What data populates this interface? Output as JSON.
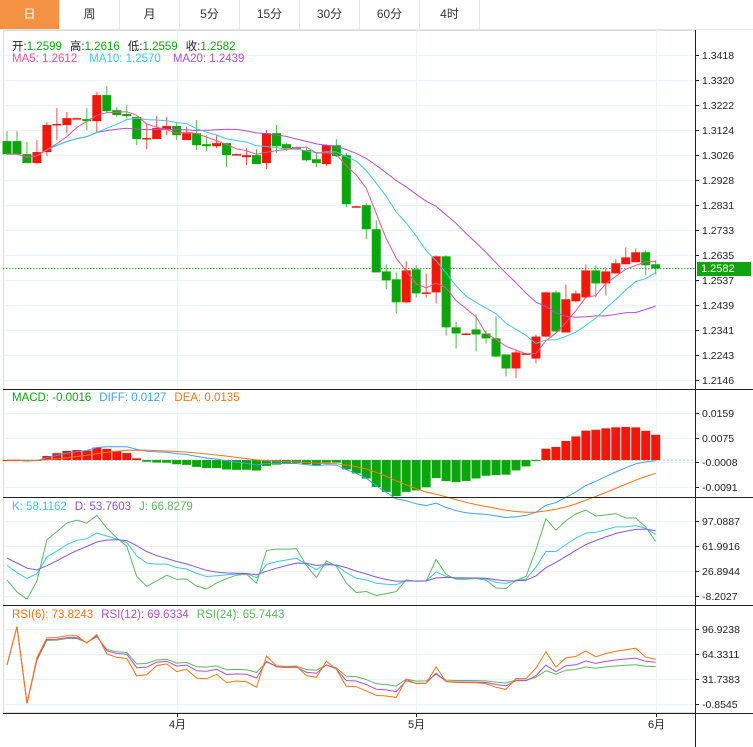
{
  "tabs": [
    "日",
    "周",
    "月",
    "5分",
    "15分",
    "30分",
    "60分",
    "4时"
  ],
  "active_tab": 0,
  "ohlc_legend": {
    "open_label": "开:",
    "open": "1.2599",
    "high_label": "高:",
    "high": "1.2616",
    "low_label": "低:",
    "low": "1.2559",
    "close_label": "收:",
    "close": "1.2582"
  },
  "ma_legend": {
    "ma5": "MA5: 1.2612",
    "ma10": "MA10: 1.2570",
    "ma20": "MA20: 1.2439"
  },
  "macd_legend": {
    "macd": "MACD: -0.0016",
    "diff": "DIFF: 0.0127",
    "dea": "DEA: 0.0135"
  },
  "kdj_legend": {
    "k": "K: 58.1162",
    "d": "D: 53.7603",
    "j": "J: 66.8279"
  },
  "rsi_legend": {
    "rsi6": "RSI(6): 73.8243",
    "rsi12": "RSI(12): 69.6334",
    "rsi24": "RSI(24): 65.7443"
  },
  "current_price": "1.2582",
  "colors": {
    "up": "#f0180a",
    "down": "#0da50d",
    "ma5": "#e8578a",
    "ma10": "#3cc8e0",
    "ma20": "#b050c8",
    "diff": "#3f9fff",
    "dea": "#ff7416",
    "k": "#3cc8e0",
    "d": "#8458d8",
    "j": "#5cb85c",
    "rsi6": "#ff7416",
    "rsi12": "#b050c8",
    "rsi24": "#5cb85c",
    "tab_active": "#f39242"
  },
  "chart_data": {
    "type": "candlestick",
    "x_ticks": [
      {
        "label": "4月",
        "index": 17
      },
      {
        "label": "5月",
        "index": 41
      },
      {
        "label": "6月",
        "index": 65
      }
    ],
    "price_axis": [
      "1.3418",
      "1.3320",
      "1.3222",
      "1.3124",
      "1.3026",
      "1.2928",
      "1.2831",
      "1.2733",
      "1.2635",
      "1.2537",
      "1.2439",
      "1.2341",
      "1.2243",
      "1.2146"
    ],
    "macd_axis": [
      "0.0159",
      "0.0075",
      "-0.0008",
      "-0.0091"
    ],
    "kdj_axis": [
      "97.0887",
      "61.9916",
      "26.8944",
      "-8.2027"
    ],
    "rsi_axis": [
      "96.9238",
      "64.3311",
      "31.7383",
      "-0.8545"
    ],
    "candles": [
      [
        1.3081,
        1.312,
        1.3026,
        1.303
      ],
      [
        1.3081,
        1.312,
        1.3026,
        1.303
      ],
      [
        1.303,
        1.3077,
        1.2995,
        1.2995
      ],
      [
        1.2995,
        1.3085,
        1.2991,
        1.3038
      ],
      [
        1.3038,
        1.3155,
        1.3022,
        1.3144
      ],
      [
        1.3144,
        1.321,
        1.3085,
        1.3148
      ],
      [
        1.3144,
        1.3195,
        1.3112,
        1.3171
      ],
      [
        1.3169,
        1.3173,
        1.3167,
        1.3171
      ],
      [
        1.3167,
        1.321,
        1.3124,
        1.3159
      ],
      [
        1.3159,
        1.3273,
        1.3116,
        1.3261
      ],
      [
        1.3261,
        1.3296,
        1.3191,
        1.3198
      ],
      [
        1.3202,
        1.3214,
        1.3175,
        1.3183
      ],
      [
        1.3187,
        1.3222,
        1.3171,
        1.3179
      ],
      [
        1.3175,
        1.3175,
        1.3065,
        1.3089
      ],
      [
        1.3091,
        1.3151,
        1.3049,
        1.3093
      ],
      [
        1.3089,
        1.3179,
        1.3112,
        1.3132
      ],
      [
        1.3128,
        1.3175,
        1.3104,
        1.314
      ],
      [
        1.314,
        1.3151,
        1.3085,
        1.3104
      ],
      [
        1.3085,
        1.3136,
        1.3085,
        1.3112
      ],
      [
        1.3112,
        1.3163,
        1.3046,
        1.3065
      ],
      [
        1.3069,
        1.3104,
        1.3042,
        1.3061
      ],
      [
        1.3061,
        1.3104,
        1.3053,
        1.3073
      ],
      [
        1.3073,
        1.3073,
        1.2979,
        1.3026
      ],
      [
        1.3029,
        1.3032,
        1.3027,
        1.303
      ],
      [
        1.3018,
        1.3053,
        1.2987,
        1.3026
      ],
      [
        1.3026,
        1.3049,
        1.2991,
        1.2991
      ],
      [
        1.2995,
        1.3124,
        1.2971,
        1.3112
      ],
      [
        1.3112,
        1.3144,
        1.3034,
        1.3061
      ],
      [
        1.3069,
        1.3073,
        1.3042,
        1.3053
      ],
      [
        1.3055,
        1.3059,
        1.3053,
        1.3057
      ],
      [
        1.3046,
        1.3057,
        1.3002,
        1.3006
      ],
      [
        1.301,
        1.3038,
        1.2979,
        1.2995
      ],
      [
        1.2991,
        1.3069,
        1.2983,
        1.3065
      ],
      [
        1.3065,
        1.3089,
        1.3018,
        1.3022
      ],
      [
        1.3026,
        1.3034,
        1.2822,
        1.2834
      ],
      [
        1.2824,
        1.2828,
        1.2822,
        1.2826
      ],
      [
        1.283,
        1.2838,
        1.2697,
        1.2736
      ],
      [
        1.2736,
        1.2771,
        1.2567,
        1.2567
      ],
      [
        1.2571,
        1.2599,
        1.2501,
        1.2536
      ],
      [
        1.254,
        1.2567,
        1.2407,
        1.245
      ],
      [
        1.245,
        1.261,
        1.2446,
        1.2575
      ],
      [
        1.2579,
        1.2595,
        1.2469,
        1.2485
      ],
      [
        1.2487,
        1.2563,
        1.2469,
        1.2489
      ],
      [
        1.2489,
        1.2634,
        1.2446,
        1.263
      ],
      [
        1.263,
        1.2634,
        1.232,
        1.2352
      ],
      [
        1.2352,
        1.2375,
        1.2269,
        1.2328
      ],
      [
        1.2326,
        1.233,
        1.2324,
        1.2328
      ],
      [
        1.2344,
        1.2403,
        1.2258,
        1.2324
      ],
      [
        1.2328,
        1.234,
        1.2289,
        1.2309
      ],
      [
        1.2309,
        1.2395,
        1.2234,
        1.2238
      ],
      [
        1.2246,
        1.2246,
        1.216,
        1.2191
      ],
      [
        1.2191,
        1.2262,
        1.2152,
        1.2254
      ],
      [
        1.2248,
        1.2252,
        1.2246,
        1.225
      ],
      [
        1.223,
        1.2324,
        1.2211,
        1.2316
      ],
      [
        1.2316,
        1.2493,
        1.2313,
        1.2489
      ],
      [
        1.2489,
        1.2497,
        1.2332,
        1.2336
      ],
      [
        1.2332,
        1.252,
        1.2332,
        1.2462
      ],
      [
        1.2454,
        1.2497,
        1.245,
        1.2485
      ],
      [
        1.2469,
        1.2599,
        1.2469,
        1.2575
      ],
      [
        1.2575,
        1.2595,
        1.2469,
        1.2524
      ],
      [
        1.2524,
        1.2587,
        1.2477,
        1.2571
      ],
      [
        1.2563,
        1.2618,
        1.2563,
        1.2603
      ],
      [
        1.2599,
        1.2665,
        1.2599,
        1.2626
      ],
      [
        1.2607,
        1.2661,
        1.2607,
        1.2646
      ],
      [
        1.2646,
        1.2654,
        1.2556,
        1.2595
      ],
      [
        1.2599,
        1.2616,
        1.2559,
        1.2582
      ]
    ],
    "candle_format": [
      "open",
      "high",
      "low",
      "close"
    ]
  }
}
